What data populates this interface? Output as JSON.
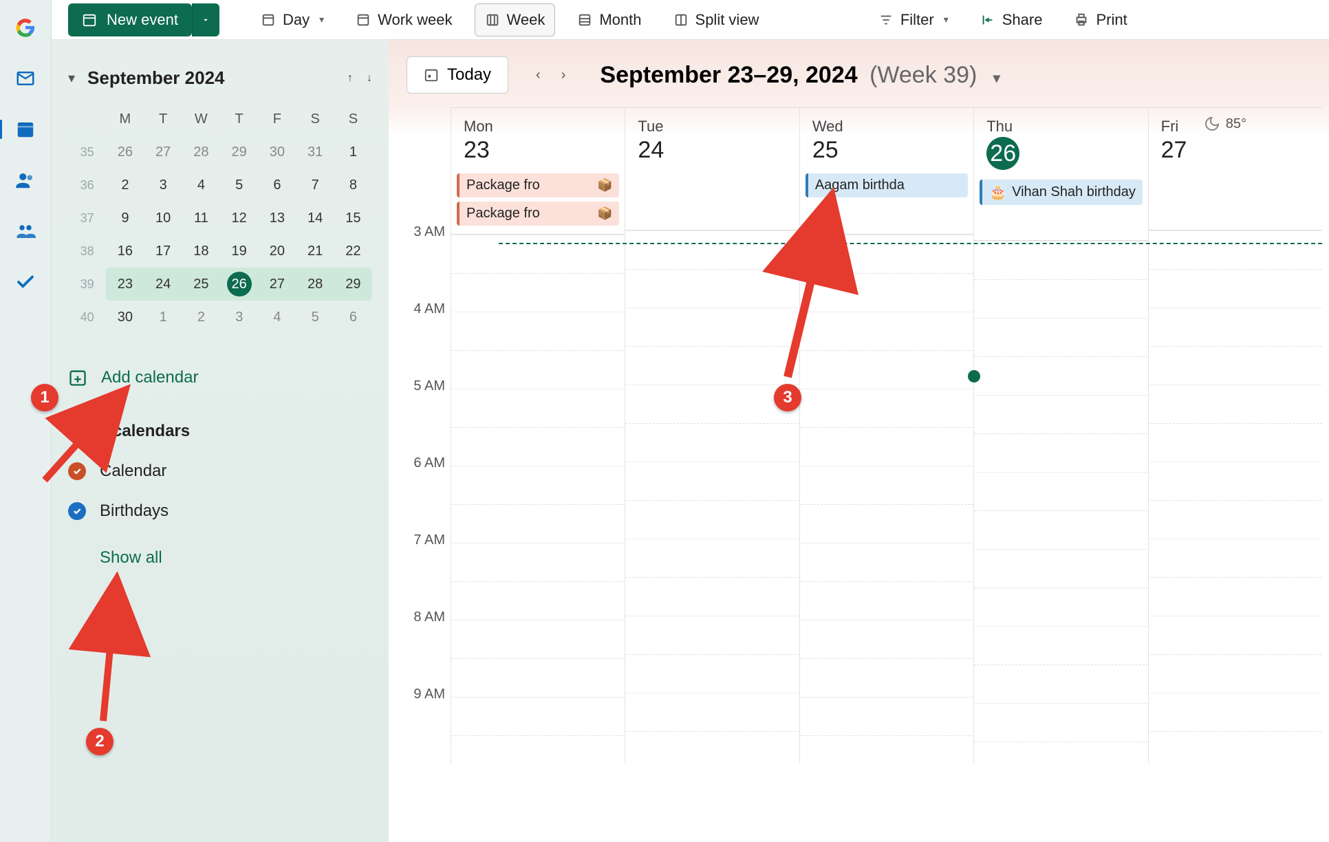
{
  "toolbar": {
    "new_event": "New event",
    "views": {
      "day": "Day",
      "workweek": "Work week",
      "week": "Week",
      "month": "Month",
      "split": "Split view"
    },
    "filter": "Filter",
    "share": "Share",
    "print": "Print"
  },
  "mini": {
    "title": "September 2024",
    "dows": [
      "M",
      "T",
      "W",
      "T",
      "F",
      "S",
      "S"
    ],
    "rows": [
      {
        "wk": "35",
        "d": [
          "26",
          "27",
          "28",
          "29",
          "30",
          "31",
          "1"
        ],
        "out": [
          0,
          1,
          2,
          3,
          4,
          5
        ]
      },
      {
        "wk": "36",
        "d": [
          "2",
          "3",
          "4",
          "5",
          "6",
          "7",
          "8"
        ]
      },
      {
        "wk": "37",
        "d": [
          "9",
          "10",
          "11",
          "12",
          "13",
          "14",
          "15"
        ]
      },
      {
        "wk": "38",
        "d": [
          "16",
          "17",
          "18",
          "19",
          "20",
          "21",
          "22"
        ]
      },
      {
        "wk": "39",
        "d": [
          "23",
          "24",
          "25",
          "26",
          "27",
          "28",
          "29"
        ],
        "cur": true,
        "today": 3
      },
      {
        "wk": "40",
        "d": [
          "30",
          "1",
          "2",
          "3",
          "4",
          "5",
          "6"
        ],
        "out": [
          1,
          2,
          3,
          4,
          5,
          6
        ]
      }
    ]
  },
  "side": {
    "add": "Add calendar",
    "group": "My calendars",
    "cals": [
      {
        "name": "Calendar",
        "c": "c1"
      },
      {
        "name": "Birthdays",
        "c": "c2"
      }
    ],
    "show_all": "Show all"
  },
  "cal": {
    "today": "Today",
    "range": "September 23–29, 2024",
    "week": "(Week 39)",
    "temp": "85°",
    "hours": [
      "3 AM",
      "4 AM",
      "5 AM",
      "6 AM",
      "7 AM",
      "8 AM",
      "9 AM"
    ],
    "days": [
      {
        "dow": "Mon",
        "num": "23",
        "ev": [
          {
            "t": "Package fro",
            "pkg": true
          },
          {
            "t": "Package fro",
            "pkg": true
          }
        ]
      },
      {
        "dow": "Tue",
        "num": "24",
        "ev": []
      },
      {
        "dow": "Wed",
        "num": "25",
        "ev": [
          {
            "t": "Aagam birthda"
          }
        ]
      },
      {
        "dow": "Thu",
        "num": "26",
        "today": true,
        "ev": [
          {
            "t": "Vihan Shah birthday",
            "cake": true
          }
        ]
      },
      {
        "dow": "Fri",
        "num": "27",
        "ev": []
      }
    ]
  },
  "anno": {
    "b1": "1",
    "b2": "2",
    "b3": "3"
  }
}
